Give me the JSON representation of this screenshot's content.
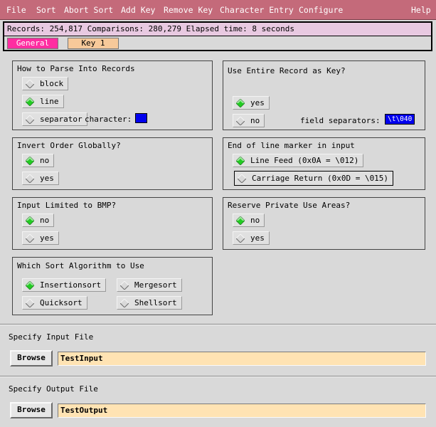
{
  "menu": {
    "file": "File",
    "sort": "Sort",
    "abort_sort": "Abort Sort",
    "add_key": "Add Key",
    "remove_key": "Remove Key",
    "character_entry": "Character Entry",
    "configure": "Configure",
    "help": "Help"
  },
  "status": {
    "text": "Records: 254,817   Comparisons: 280,279   Elapsed time: 8 seconds"
  },
  "tabs": [
    "General",
    "Key 1"
  ],
  "parse": {
    "title": "How to Parse Into Records",
    "options": [
      "block",
      "line",
      "separator"
    ],
    "selected": "line",
    "character_label": "character:"
  },
  "entire_key": {
    "title": "Use Entire Record as Key?",
    "options": [
      "yes",
      "no"
    ],
    "selected": "yes",
    "field_sep_label": "field separators:",
    "field_sep_value": "\\t\\040"
  },
  "invert": {
    "title": "Invert Order Globally?",
    "options": [
      "no",
      "yes"
    ],
    "selected": "no"
  },
  "eol": {
    "title": "End of line marker in input",
    "options": [
      "Line Feed (0x0A = \\012)",
      "Carriage Return (0x0D = \\015)"
    ],
    "selected": "Line Feed (0x0A = \\012)"
  },
  "bmp": {
    "title": "Input Limited to BMP?",
    "options": [
      "no",
      "yes"
    ],
    "selected": "no"
  },
  "private_use": {
    "title": "Reserve Private Use Areas?",
    "options": [
      "no",
      "yes"
    ],
    "selected": "no"
  },
  "algorithm": {
    "title": "Which Sort Algorithm to Use",
    "options": [
      "Insertionsort",
      "Mergesort",
      "Quicksort",
      "Shellsort"
    ],
    "selected": "Insertionsort"
  },
  "input_file": {
    "title": "Specify Input File",
    "browse_label": "Browse",
    "value": "TestInput"
  },
  "output_file": {
    "title": "Specify Output File",
    "browse_label": "Browse",
    "value": "TestOutput"
  },
  "colors": {
    "menubar": "#c46a7a",
    "status_bg": "#e8c9e1",
    "active_tab": "#ff2da1",
    "inactive_tab": "#f7c99a",
    "selected_indicator": "#22cc22",
    "swatch": "#0000ee",
    "file_field": "#ffe3b3"
  }
}
